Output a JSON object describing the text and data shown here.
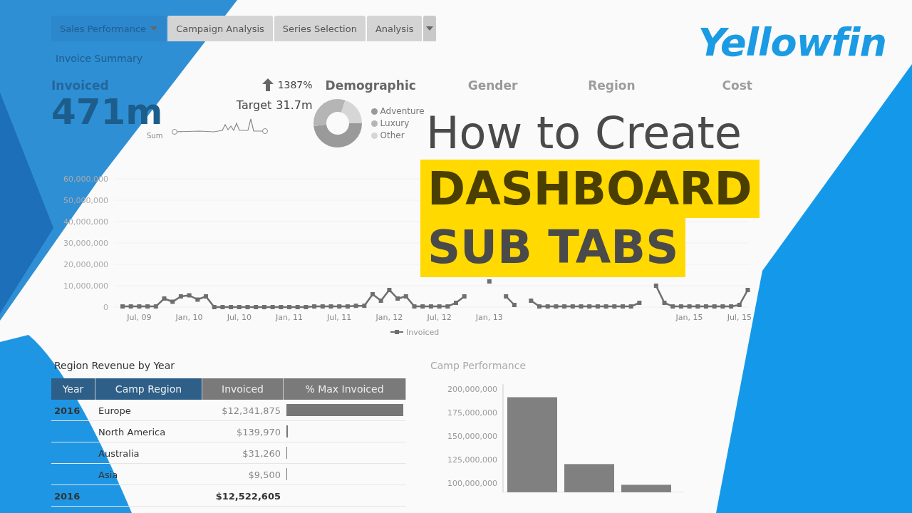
{
  "tabs": [
    {
      "label": "Sales Performance",
      "selected": true,
      "caret": true
    },
    {
      "label": "Campaign Analysis",
      "selected": false,
      "caret": false
    },
    {
      "label": "Series Selection",
      "selected": false,
      "caret": false
    },
    {
      "label": "Analysis",
      "selected": false,
      "caret": false
    }
  ],
  "report_title": "Invoice Summary",
  "kpis": {
    "invoiced": {
      "label": "Invoiced",
      "value": "471m",
      "caption": "Sum"
    },
    "change": {
      "value": "1387%"
    },
    "target": {
      "label": "Target",
      "value": "31.7m"
    },
    "demographic": {
      "title": "Demographic",
      "legend": [
        {
          "label": "Adventure",
          "color": "#9a9a9a"
        },
        {
          "label": "Luxury",
          "color": "#b5b5b5"
        },
        {
          "label": "Other",
          "color": "#d6d6d6"
        }
      ]
    },
    "faded_titles": [
      "Gender",
      "Region",
      "Cost"
    ]
  },
  "line_chart": {
    "chart_data": {
      "type": "line",
      "ylim": [
        0,
        60000000
      ],
      "yticks": [
        {
          "value": 0,
          "label": "0"
        },
        {
          "value": 10000000,
          "label": "10,000,000"
        },
        {
          "value": 20000000,
          "label": "20,000,000"
        },
        {
          "value": 30000000,
          "label": "30,000,000"
        },
        {
          "value": 40000000,
          "label": "40,000,000"
        },
        {
          "value": 50000000,
          "label": "50,000,000"
        },
        {
          "value": 60000000,
          "label": "60,000,000"
        }
      ],
      "categories": [
        null,
        null,
        "Jul, 09",
        null,
        null,
        null,
        null,
        null,
        "Jan, 10",
        null,
        null,
        null,
        null,
        null,
        "Jul, 10",
        null,
        null,
        null,
        null,
        null,
        "Jan, 11",
        null,
        null,
        null,
        null,
        null,
        "Jul, 11",
        null,
        null,
        null,
        null,
        null,
        "Jan, 12",
        null,
        null,
        null,
        null,
        null,
        "Jul, 12",
        null,
        null,
        null,
        null,
        null,
        "Jan, 13",
        null,
        null,
        null,
        null,
        null,
        null,
        null,
        null,
        null,
        null,
        null,
        null,
        null,
        null,
        null,
        null,
        null,
        null,
        null,
        null,
        null,
        null,
        null,
        "Jan, 15",
        null,
        null,
        null,
        null,
        null,
        "Jul, 15",
        null
      ],
      "series": [
        {
          "name": "Invoiced",
          "color": "#6e6e6e",
          "marker": "square",
          "values": [
            300000,
            300000,
            300000,
            300000,
            300000,
            4000000,
            2500000,
            5000000,
            5500000,
            3500000,
            5000000,
            0,
            0,
            0,
            0,
            0,
            0,
            0,
            0,
            0,
            0,
            0,
            0,
            300000,
            300000,
            300000,
            300000,
            300000,
            600000,
            600000,
            6000000,
            3000000,
            8000000,
            4000000,
            5000000,
            300000,
            300000,
            300000,
            300000,
            300000,
            2000000,
            5000000,
            null,
            null,
            12000000,
            null,
            5000000,
            1000000,
            null,
            3000000,
            300000,
            300000,
            300000,
            300000,
            300000,
            300000,
            300000,
            300000,
            300000,
            300000,
            300000,
            300000,
            2000000,
            null,
            10000000,
            2000000,
            300000,
            300000,
            300000,
            300000,
            300000,
            300000,
            300000,
            300000,
            1000000,
            8000000
          ]
        }
      ]
    }
  },
  "region_table": {
    "title": "Region Revenue by Year",
    "columns": [
      "Year",
      "Camp Region",
      "Invoiced",
      "% Max Invoiced"
    ],
    "rows": [
      {
        "year": "2016",
        "region": "Europe",
        "invoiced": "$12,341,875",
        "level": 1.0
      },
      {
        "region": "North America",
        "invoiced": "$139,970",
        "level": 0.011
      },
      {
        "region": "Australia",
        "invoiced": "$31,260",
        "level": 0.0025
      },
      {
        "region": "Asia",
        "invoiced": "$9,500",
        "level": 0.0008
      }
    ],
    "total": {
      "year": "2016",
      "invoiced": "$12,522,605"
    }
  },
  "bar_chart": {
    "title": "Camp Performance",
    "chart_data": {
      "type": "bar",
      "categories": [
        null,
        null,
        null
      ],
      "ylim": [
        90000000,
        205000000
      ],
      "yticks": [
        {
          "value": 100000000,
          "label": "100,000,000"
        },
        {
          "value": 125000000,
          "label": "125,000,000"
        },
        {
          "value": 150000000,
          "label": "150,000,000"
        },
        {
          "value": 175000000,
          "label": "175,000,000"
        },
        {
          "value": 200000000,
          "label": "200,000,000"
        }
      ],
      "series": [
        {
          "color": "#808080",
          "values": [
            191000000,
            120000000,
            98000000
          ]
        }
      ]
    }
  },
  "overlay": {
    "logo": "Yellowfin",
    "heading": "How to Create",
    "highlight_lines": [
      "DASHBOARD",
      "SUB TABS"
    ]
  }
}
